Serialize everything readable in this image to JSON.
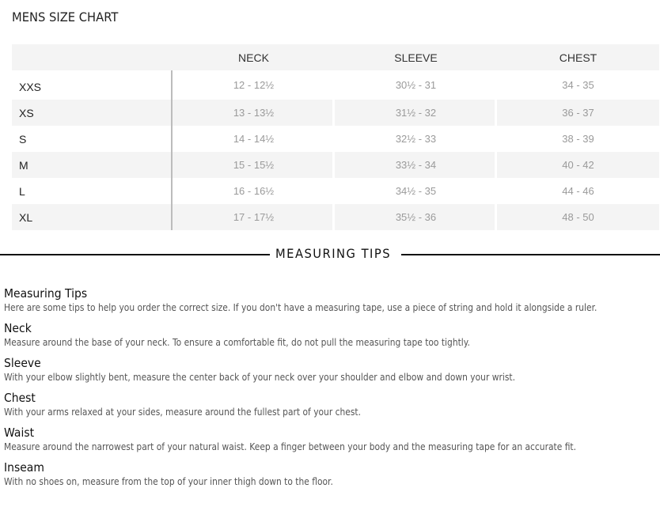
{
  "title": "MENS SIZE CHART",
  "table": {
    "columns": [
      "",
      "NECK",
      "SLEEVE",
      "CHEST"
    ],
    "rows": [
      {
        "size": "XXS",
        "neck": "12 - 12½",
        "sleeve": "30½ - 31",
        "chest": "34 - 35"
      },
      {
        "size": "XS",
        "neck": "13 - 13½",
        "sleeve": "31½ - 32",
        "chest": "36 - 37"
      },
      {
        "size": "S",
        "neck": "14 - 14½",
        "sleeve": "32½ - 33",
        "chest": "38 - 39"
      },
      {
        "size": "M",
        "neck": "15 - 15½",
        "sleeve": "33½ - 34",
        "chest": "40 - 42"
      },
      {
        "size": "L",
        "neck": "16 - 16½",
        "sleeve": "34½ - 35",
        "chest": "44 - 46"
      },
      {
        "size": "XL",
        "neck": "17 - 17½",
        "sleeve": "35½ - 36",
        "chest": "48 - 50"
      }
    ]
  },
  "divider_label": "MEASURING TIPS",
  "tips": [
    {
      "title": "Measuring Tips",
      "text": "Here are some tips to help you order the correct size. If you don't have a measuring tape, use a piece of string and hold it alongside a ruler."
    },
    {
      "title": "Neck",
      "text": "Measure around the base of your neck. To ensure a comfortable fit, do not pull the measuring tape too tightly."
    },
    {
      "title": "Sleeve",
      "text": "With your elbow slightly bent, measure the center back of your neck over your shoulder and elbow and down your wrist."
    },
    {
      "title": "Chest",
      "text": "With your arms relaxed at your sides, measure around the fullest part of your chest."
    },
    {
      "title": "Waist",
      "text": "Measure around the narrowest part of your natural waist. Keep a finger between your body and the measuring tape for an accurate fit."
    },
    {
      "title": "Inseam",
      "text": "With no shoes on, measure from the top of your inner thigh down to the floor."
    }
  ]
}
